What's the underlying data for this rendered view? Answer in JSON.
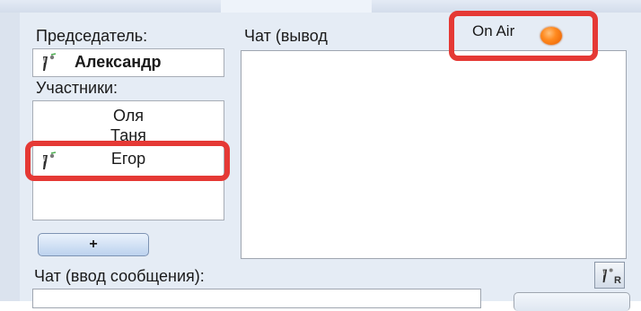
{
  "chair": {
    "label": "Председатель:",
    "name": "Александр",
    "icon": "microphone-icon"
  },
  "participants": {
    "label": "Участники:",
    "items": [
      {
        "name": "Оля",
        "has_mic": false
      },
      {
        "name": "Таня",
        "has_mic": false
      },
      {
        "name": "Егор",
        "has_mic": true
      }
    ],
    "add_label": "+"
  },
  "chat_output": {
    "label": "Чат (вывод"
  },
  "on_air": {
    "label": "On Air",
    "indicator_color": "#ff8a1f"
  },
  "chat_input": {
    "label": "Чат (ввод сообщения):",
    "value": "",
    "r_button_label": "R"
  },
  "colors": {
    "highlight": "#e53935",
    "panel_background": "#e5ecf5"
  }
}
